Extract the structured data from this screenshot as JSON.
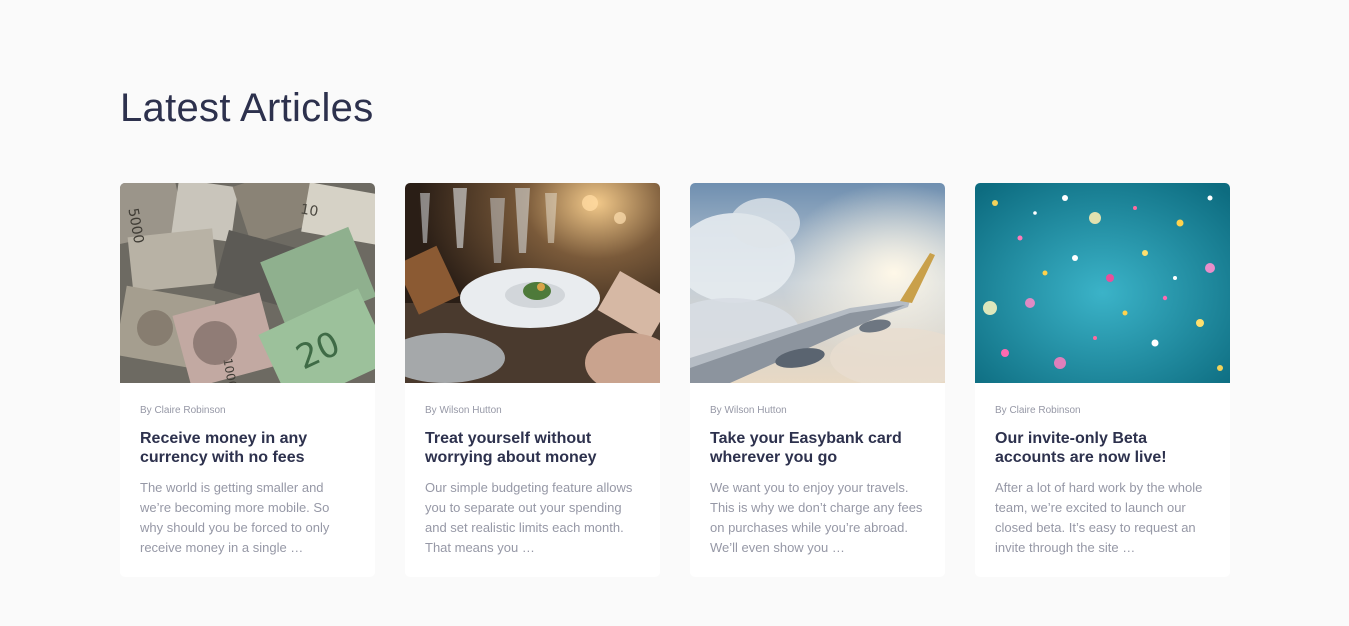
{
  "section": {
    "title": "Latest Articles"
  },
  "articles": [
    {
      "author": "By Claire Robinson",
      "title": "Receive money in any currency with no fees",
      "excerpt": "The world is getting smaller and we’re becoming more mobile. So why should you be forced to only receive money in a single …",
      "image_alt": "currency",
      "image_subject": "banknotes"
    },
    {
      "author": "By Wilson Hutton",
      "title": "Treat yourself without worrying about money",
      "excerpt": "Our simple budgeting feature allows you to separate out your spending and set realistic limits each month. That means you …",
      "image_alt": "restaurant",
      "image_subject": "dinner table"
    },
    {
      "author": "By Wilson Hutton",
      "title": "Take your Easybank card wherever you go",
      "excerpt": "We want you to enjoy your travels. This is why we don’t charge any fees on purchases while you’re abroad. We’ll even show you …",
      "image_alt": "plane",
      "image_subject": "airplane wing above clouds"
    },
    {
      "author": "By Claire Robinson",
      "title": "Our invite-only Beta accounts are now live!",
      "excerpt": "After a lot of hard work by the whole team, we’re excited to launch our closed beta. It’s easy to request an invite through the site …",
      "image_alt": "confetti",
      "image_subject": "confetti on teal background"
    }
  ]
}
